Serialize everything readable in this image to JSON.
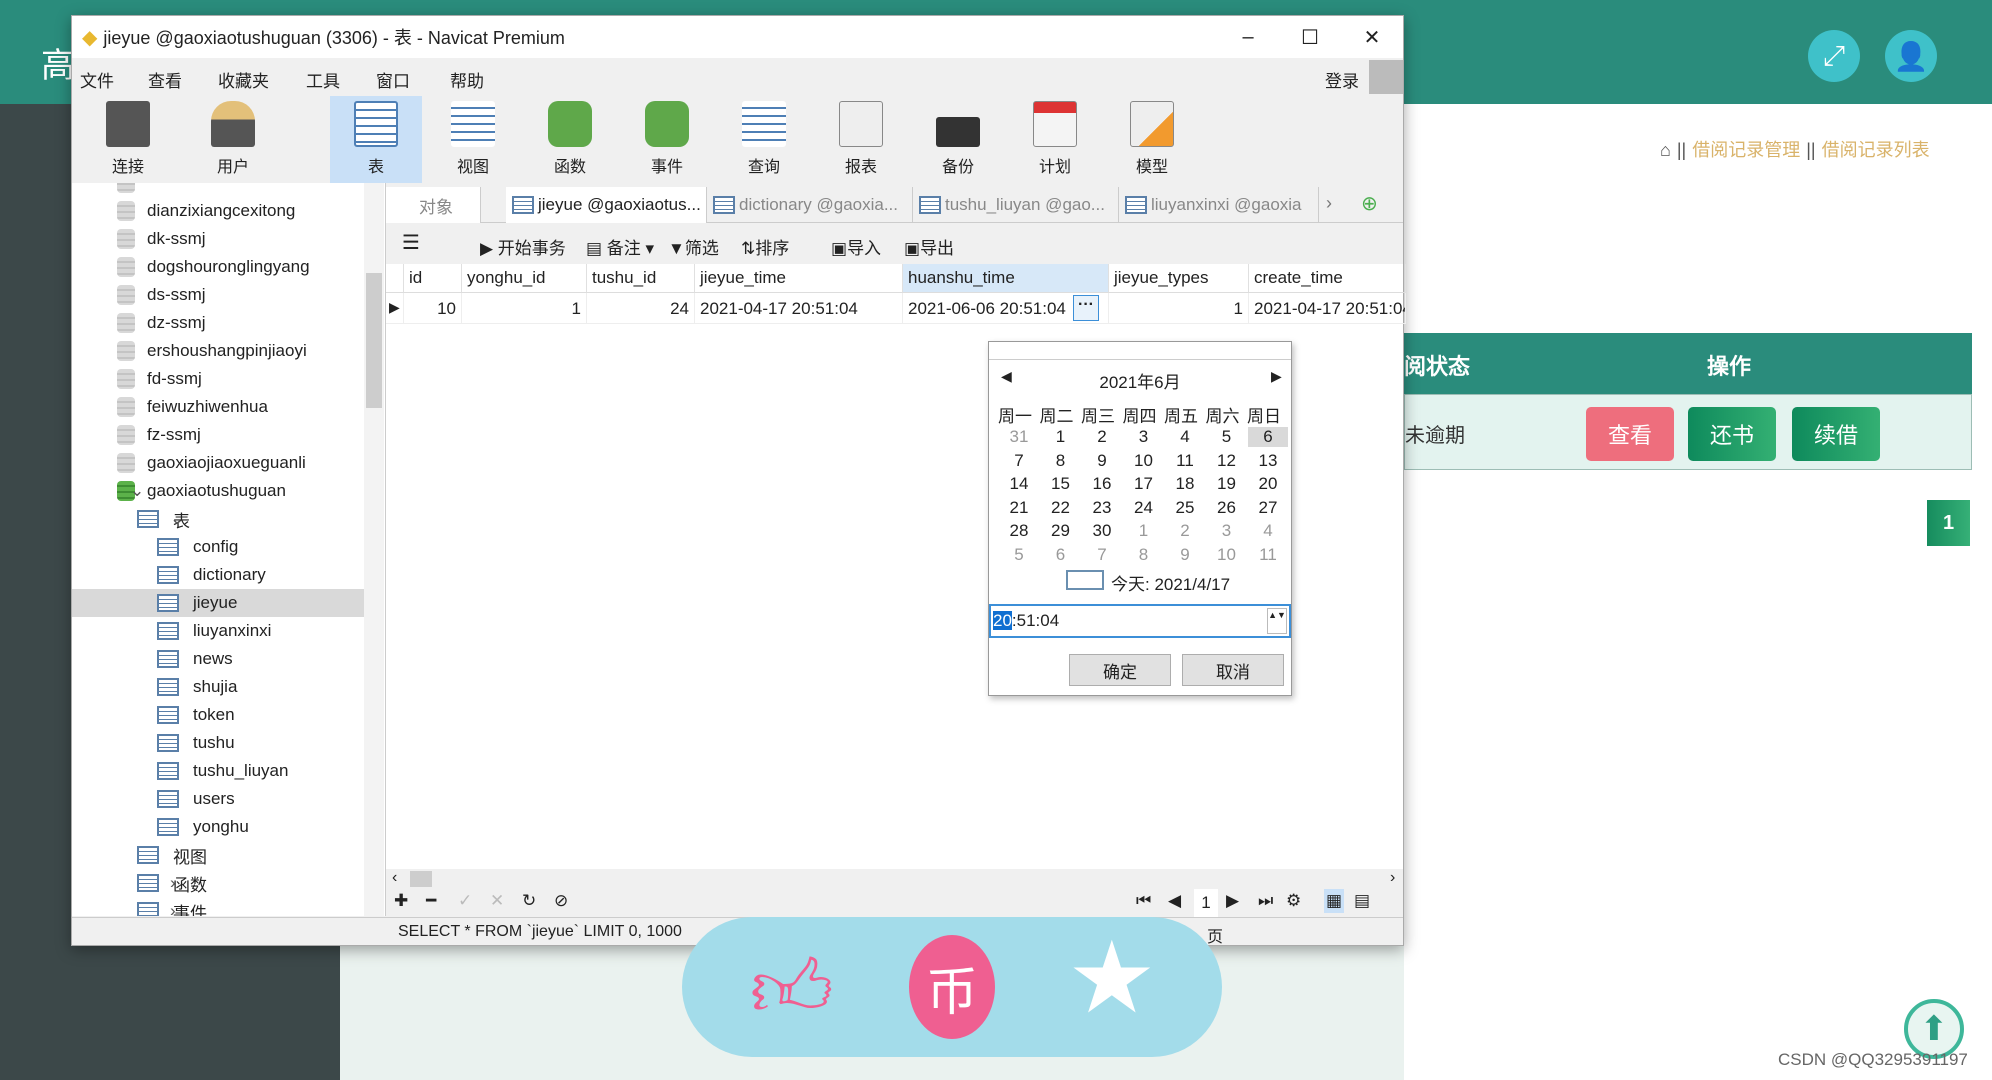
{
  "web": {
    "logo_char": "高",
    "breadcrumb": [
      "借阅记录管理",
      "借阅记录列表"
    ],
    "table_headers": [
      "阅状态",
      "操作"
    ],
    "row_status": "未逾期",
    "buttons": {
      "view": "查看",
      "return": "还书",
      "renew": "续借"
    },
    "page": "1",
    "watermark": "CSDN @QQ3295391197",
    "colors": {
      "brand": "#2a8c7c",
      "view_btn": "#ee6e7d",
      "green_btn": "#1e9463"
    }
  },
  "window": {
    "title": "jieyue @gaoxiaotushuguan (3306) - 表 - Navicat Premium",
    "login": "登录",
    "menu": [
      "文件",
      "查看",
      "收藏夹",
      "工具",
      "窗口",
      "帮助"
    ],
    "toolbar": [
      "连接",
      "用户",
      "表",
      "视图",
      "函数",
      "事件",
      "查询",
      "报表",
      "备份",
      "计划",
      "模型"
    ],
    "toolbar_active": "表",
    "tree_dbs": [
      "dianzixiangcexitong",
      "dk-ssmj",
      "dogshouronglingyang",
      "ds-ssmj",
      "dz-ssmj",
      "ershoushangpinjiaoyi",
      "fd-ssmj",
      "feiwuzhiwenhua",
      "fz-ssmj",
      "gaoxiaojiaoxueguanli"
    ],
    "open_db": "gaoxiaotushuguan",
    "tables_node": "表",
    "tables": [
      "config",
      "dictionary",
      "jieyue",
      "liuyanxinxi",
      "news",
      "shujia",
      "token",
      "tushu",
      "tushu_liuyan",
      "users",
      "yonghu"
    ],
    "selected_table": "jieyue",
    "views_node": "视图",
    "funcs_node": "函数",
    "events_node": "事件",
    "tabs": [
      "对象",
      "jieyue @gaoxiaotus...",
      "dictionary @gaoxia...",
      "tushu_liuyan @gao...",
      "liuyanxinxi @gaoxia"
    ],
    "obj_toolbar": [
      "开始事务",
      "备注",
      "筛选",
      "排序",
      "导入",
      "导出"
    ],
    "columns": [
      "id",
      "yonghu_id",
      "tushu_id",
      "jieyue_time",
      "huanshu_time",
      "jieyue_types",
      "create_time"
    ],
    "row": [
      "10",
      "1",
      "24",
      "2021-04-17 20:51:04",
      "2021-06-06 20:51:04",
      "1",
      "2021-04-17 20:51:04"
    ],
    "page_num": "1",
    "sql": "SELECT * FROM `jieyue` LIMIT 0, 1000",
    "page_suffix": "页"
  },
  "calendar": {
    "month": "2021年6月",
    "weekdays": [
      "周一",
      "周二",
      "周三",
      "周四",
      "周五",
      "周六",
      "周日"
    ],
    "days": [
      [
        "31",
        "1",
        "2",
        "3",
        "4",
        "5",
        "6"
      ],
      [
        "7",
        "8",
        "9",
        "10",
        "11",
        "12",
        "13"
      ],
      [
        "14",
        "15",
        "16",
        "17",
        "18",
        "19",
        "20"
      ],
      [
        "21",
        "22",
        "23",
        "24",
        "25",
        "26",
        "27"
      ],
      [
        "28",
        "29",
        "30",
        "1",
        "2",
        "3",
        "4"
      ],
      [
        "5",
        "6",
        "7",
        "8",
        "9",
        "10",
        "11"
      ]
    ],
    "selected": "6",
    "today": "今天: 2021/4/17",
    "time_sel": "20",
    "time_rest": ":51:04",
    "ok": "确定",
    "cancel": "取消"
  }
}
